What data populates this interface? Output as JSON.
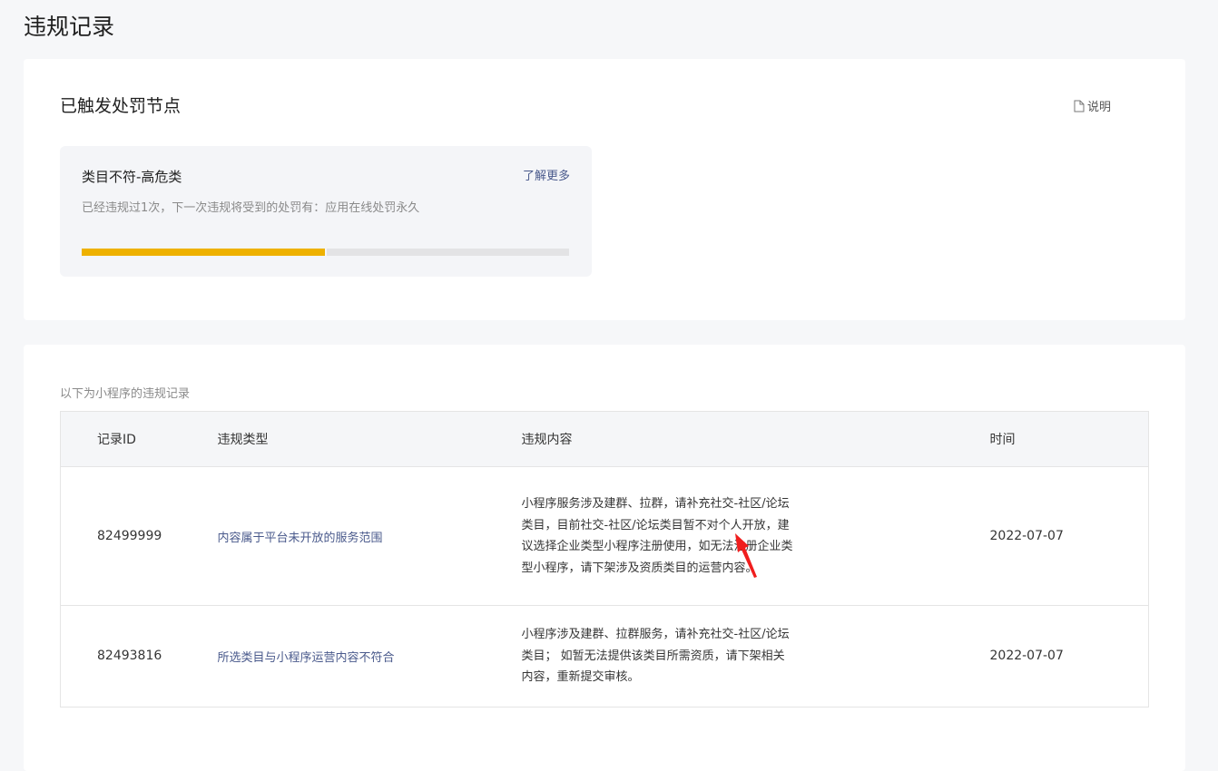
{
  "page_title": "违规记录",
  "penalty": {
    "title": "已触发处罚节点",
    "help_label": "说明",
    "node": {
      "name": "类目不符-高危类",
      "learn_more": "了解更多",
      "description": "已经违规过1次，下一次违规将受到的处罚有：应用在线处罚永久",
      "progress_segments": 2,
      "progress_filled": 1,
      "progress_color": "#eeb100"
    }
  },
  "records": {
    "intro": "以下为小程序的违规记录",
    "columns": [
      "记录ID",
      "违规类型",
      "违规内容",
      "时间"
    ],
    "rows": [
      {
        "id": "82499999",
        "type": "内容属于平台未开放的服务范围",
        "content": "小程序服务涉及建群、拉群，请补充社交-社区/论坛类目，目前社交-社区/论坛类目暂不对个人开放，建议选择企业类型小程序注册使用，如无法注册企业类型小程序，请下架涉及资质类目的运营内容。",
        "time": "2022-07-07"
      },
      {
        "id": "82493816",
        "type": "所选类目与小程序运营内容不符合",
        "content": "小程序涉及建群、拉群服务，请补充社交-社区/论坛类目； 如暂无法提供该类目所需资质，请下架相关内容，重新提交审核。",
        "time": "2022-07-07"
      }
    ]
  }
}
